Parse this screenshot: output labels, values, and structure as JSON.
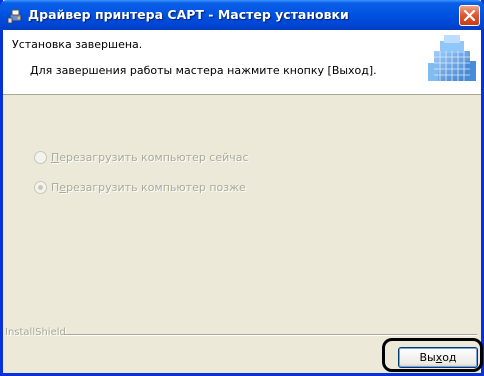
{
  "window": {
    "title": "Драйвер принтера CAPT - Мастер установки",
    "app_icon": "installer-icon",
    "close_icon": "close-icon"
  },
  "header": {
    "title": "Установка завершена.",
    "subtitle": "Для завершения работы мастера нажмите кнопку [Выход].",
    "image": "printer-cubes-graphic"
  },
  "options": [
    {
      "pre": "",
      "accel": "П",
      "post": "ерезагрузить компьютер сейчас",
      "selected": false,
      "enabled": false
    },
    {
      "pre": "П",
      "accel": "е",
      "post": "резагрузить компьютер позже",
      "selected": true,
      "enabled": false
    }
  ],
  "footer": {
    "brand": "InstallShield",
    "exit_pre": "Вы",
    "exit_accel": "х",
    "exit_post": "од"
  }
}
